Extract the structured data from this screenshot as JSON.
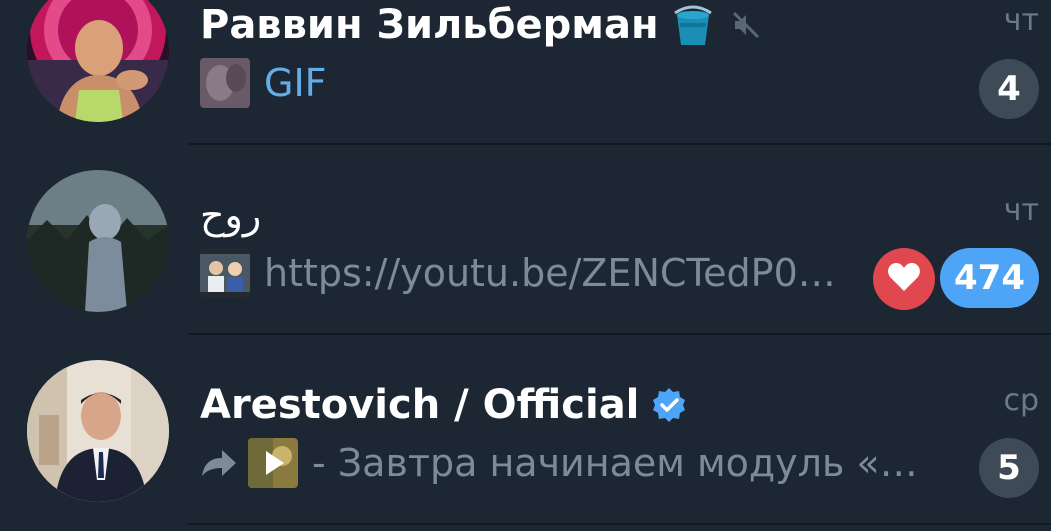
{
  "chats": [
    {
      "title": "Раввин Зильберман",
      "emoji_status_icon": "bucket-icon",
      "muted": true,
      "date": "чт",
      "preview_accent": "GIF",
      "unread": "4"
    },
    {
      "title": "روح",
      "date": "чт",
      "preview": "https://youtu.be/ZENCTedP0E...",
      "reaction_icon": "heart-icon",
      "unread": "474"
    },
    {
      "title": "Arestovich / Official",
      "verified": true,
      "date": "ср",
      "forward_icon": "forward-arrow-icon",
      "preview": "- Завтра начинаем модуль «Ис...",
      "unread": "5"
    }
  ],
  "colors": {
    "background": "#1d2733",
    "title": "#ffffff",
    "accent_link": "#63aee9",
    "preview_text": "#7d8a98",
    "date": "#6b7a89",
    "badge_muted": "#3e4a56",
    "badge_unmuted": "#4ea4f6",
    "reaction": "#e0474f",
    "verified": "#4ea4f6"
  }
}
